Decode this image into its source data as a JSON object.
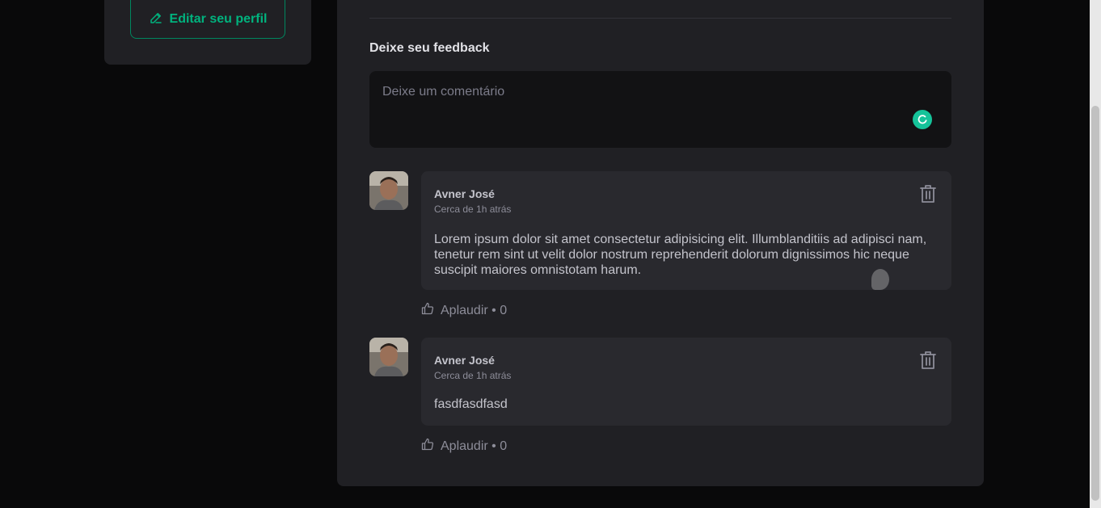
{
  "sidebar": {
    "edit_profile_label": "Editar seu perfil"
  },
  "feedback": {
    "title": "Deixe seu feedback",
    "comment_placeholder": "Deixe um comentário"
  },
  "comments": [
    {
      "author": "Avner José",
      "time": "Cerca de 1h atrás",
      "text": "Lorem ipsum dolor sit amet consectetur adipisicing elit. Illumblanditiis ad adipisci nam, tenetur rem sint ut velit dolor nostrum reprehenderit dolorum dignissimos hic neque suscipit maiores omnistotam harum.",
      "applaud_label": "Aplaudir • 0"
    },
    {
      "author": "Avner José",
      "time": "Cerca de 1h atrás",
      "text": "fasdfasdfasd",
      "applaud_label": "Aplaudir • 0"
    }
  ],
  "colors": {
    "background": "#09090a",
    "card": "#202024",
    "accent": "#00b37e",
    "grammarly": "#15c39a"
  },
  "icons": {
    "edit": "pencil-icon",
    "delete": "trash-icon",
    "applaud": "thumbs-up-icon",
    "grammar": "grammarly-icon"
  }
}
